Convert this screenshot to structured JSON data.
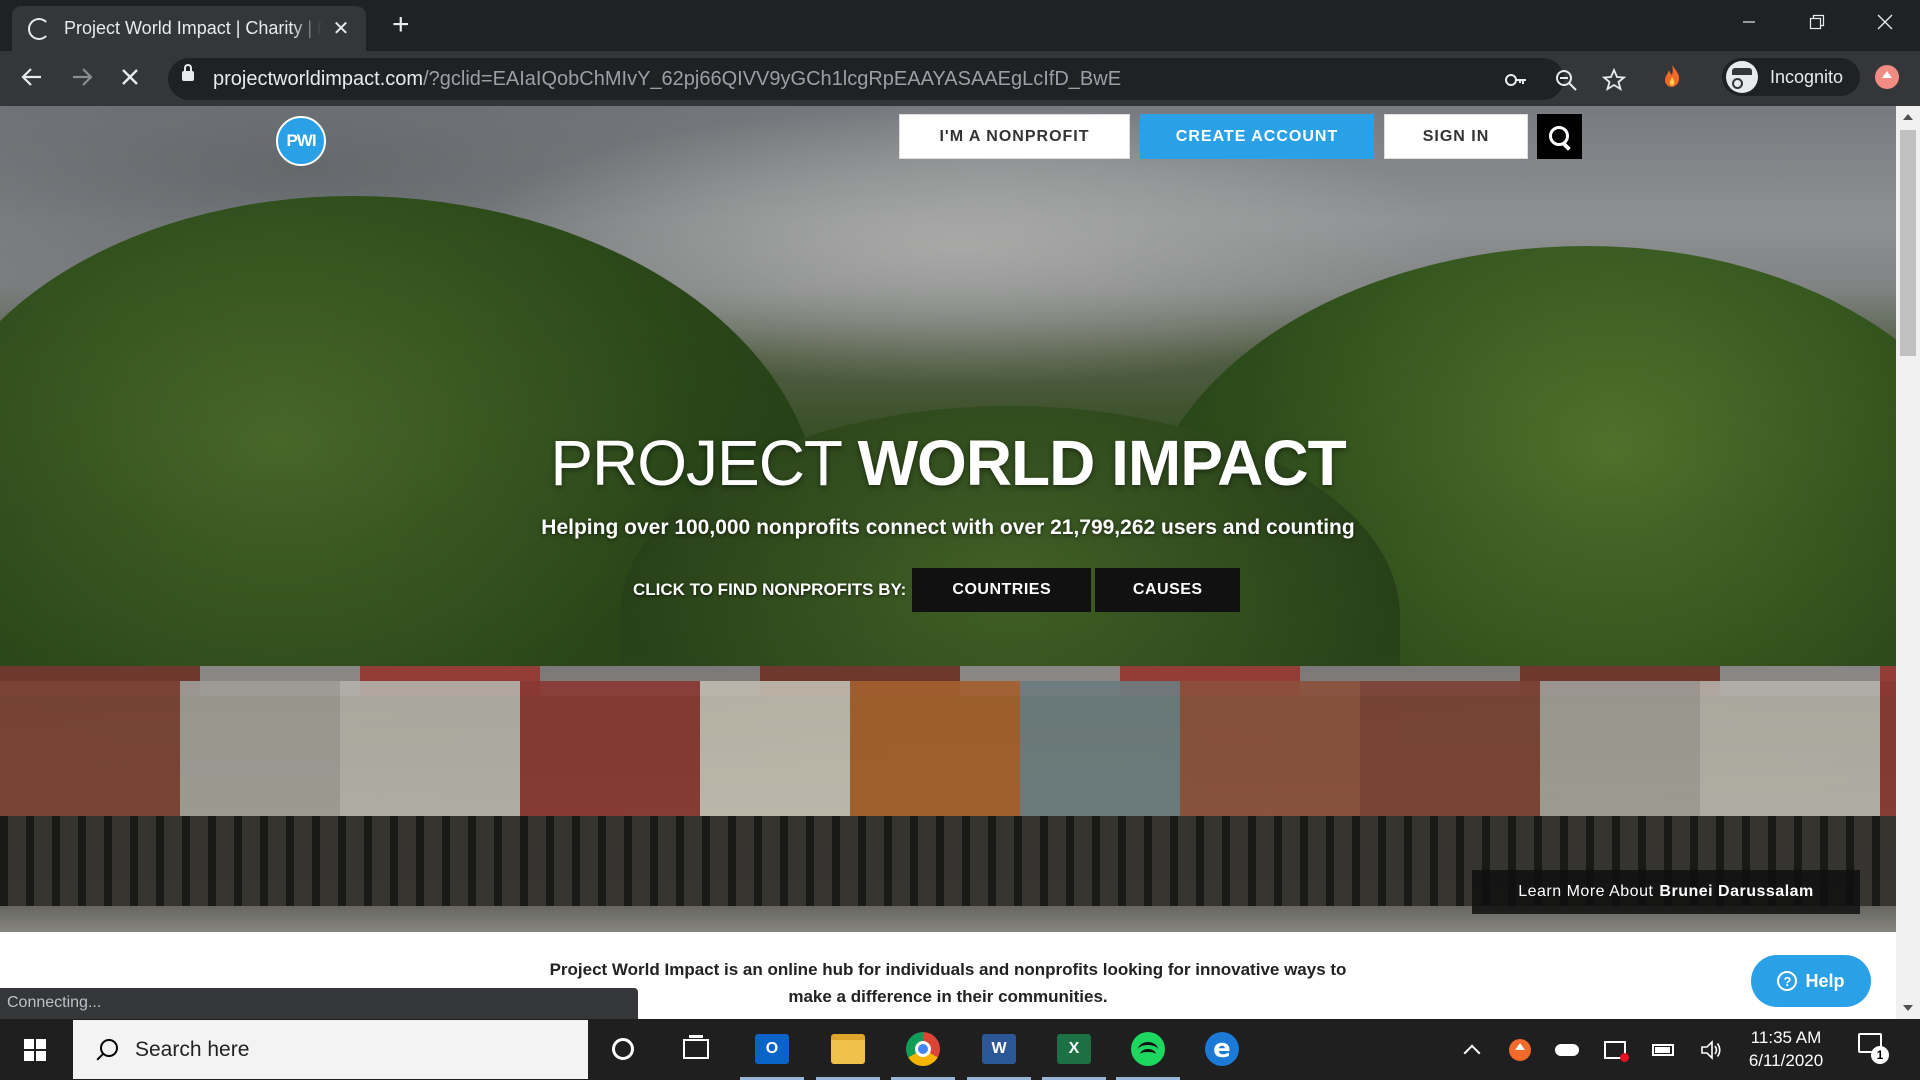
{
  "browser": {
    "tab_title": "Project World Impact | Charity | N",
    "tab_close": "✕",
    "new_tab": "+",
    "url_host": "projectworldimpact.com",
    "url_rest": "/?gclid=EAIaIQobChMIvY_62pj66QIVV9yGCh1lcgRpEAAYASAAEgLcIfD_BwE",
    "profile_label": "Incognito",
    "status_text": "Connecting..."
  },
  "site": {
    "logo_text": "PWI",
    "nav": {
      "nonprofit_label": "I'M A NONPROFIT",
      "create_label": "CREATE ACCOUNT",
      "signin_label": "SIGN IN"
    },
    "hero": {
      "title_light": "PROJECT",
      "title_bold": "WORLD IMPACT",
      "subtitle": "Helping over 100,000 nonprofits connect with over 21,799,262 users and counting",
      "find_label": "CLICK TO FIND NONPROFITS BY:",
      "countries_label": "COUNTRIES",
      "causes_label": "CAUSES",
      "learn_more_prefix": "Learn More About",
      "learn_more_country": "Brunei Darussalam"
    },
    "intro_line1": "Project World Impact is an online hub for individuals and nonprofits looking for innovative ways to",
    "intro_line2": "make a difference in their communities.",
    "help_label": "Help",
    "help_icon_glyph": "?"
  },
  "taskbar": {
    "search_placeholder": "Search here",
    "outlook_glyph": "O",
    "word_glyph": "W",
    "excel_glyph": "X",
    "edge_glyph": "e",
    "time": "11:35 AM",
    "date": "6/11/2020",
    "notification_count": "1"
  },
  "colors": {
    "brand_blue": "#2aa0e6",
    "chrome_dark": "#202124",
    "chrome_toolbar": "#35363a"
  }
}
